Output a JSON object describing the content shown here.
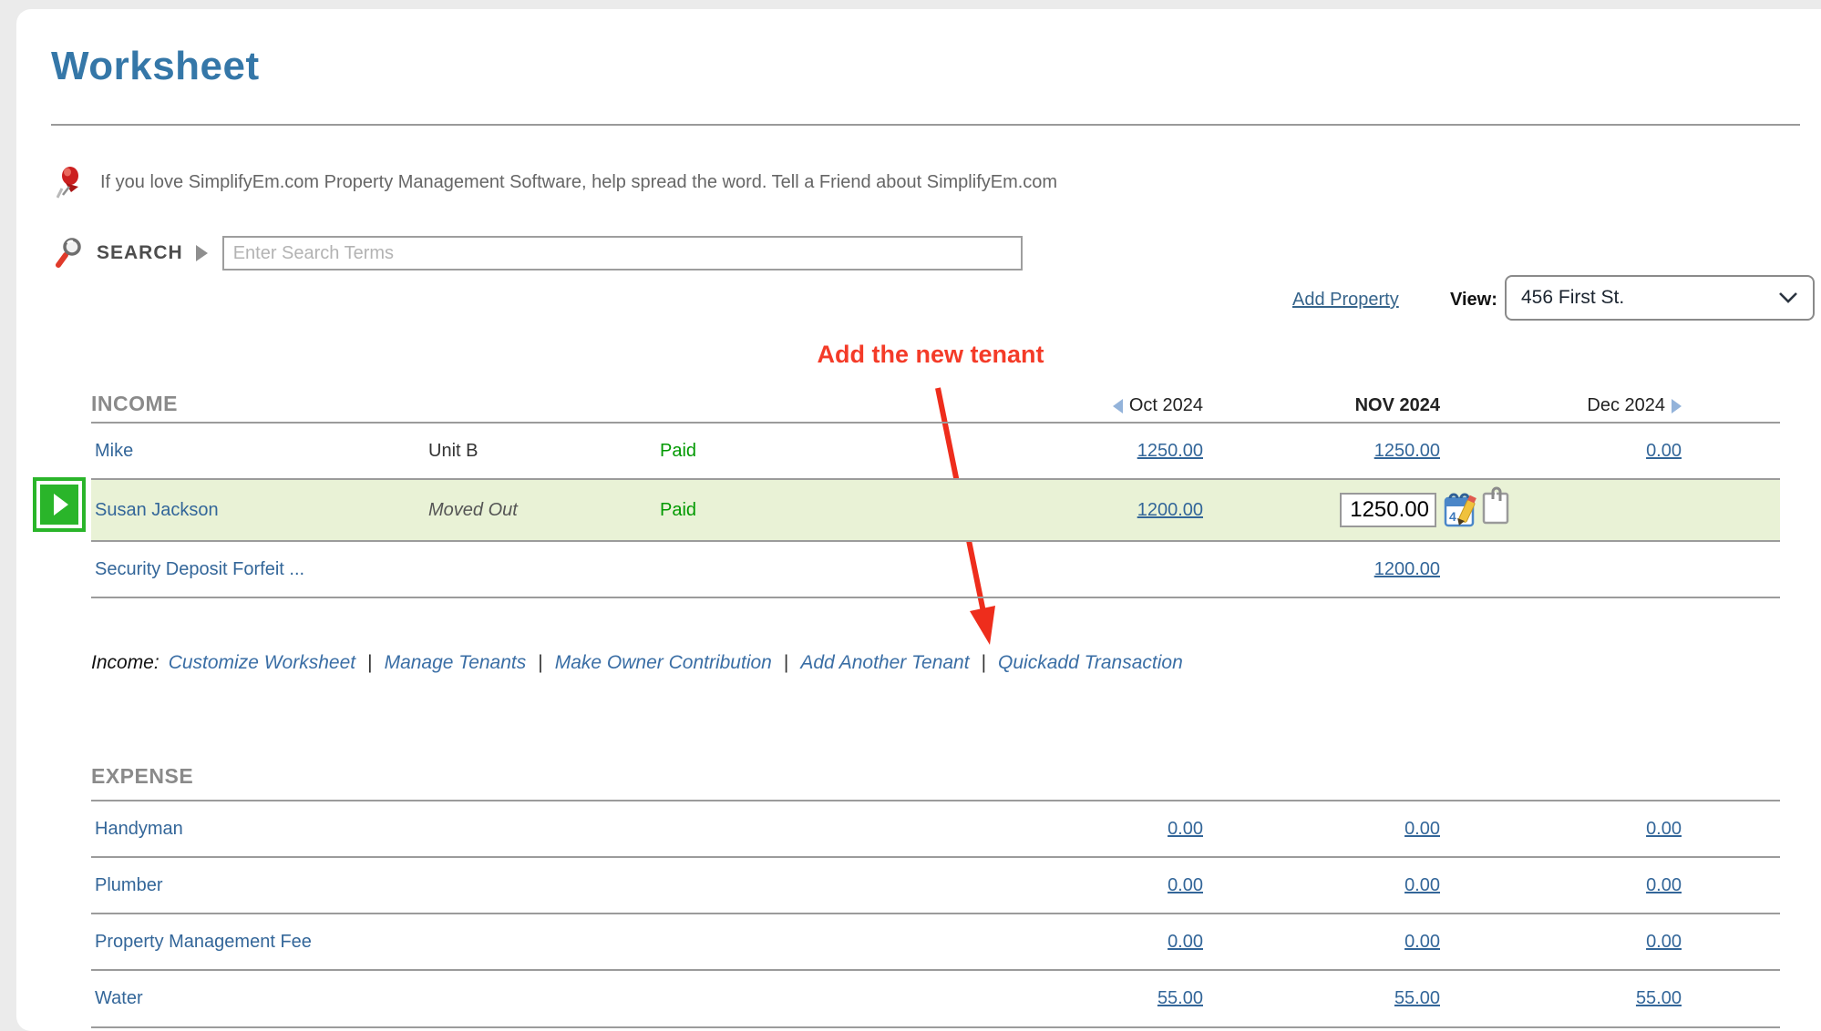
{
  "page": {
    "title": "Worksheet"
  },
  "share": {
    "text": "If you love SimplifyEm.com Property Management Software, help spread the word. Tell a Friend about SimplifyEm.com"
  },
  "search": {
    "label": "SEARCH",
    "placeholder": "Enter Search Terms"
  },
  "property_bar": {
    "add_property": "Add Property",
    "view_label": "View:",
    "view_value": "456 First St."
  },
  "annotation": {
    "text": "Add the new tenant"
  },
  "months": {
    "prev": "Oct 2024",
    "current": "NOV 2024",
    "next": "Dec 2024"
  },
  "income": {
    "section_label": "INCOME",
    "rows": [
      {
        "name": "Mike",
        "unit": "Unit B",
        "status": "Paid",
        "oct": "1250.00",
        "nov": "1250.00",
        "dec": "0.00"
      },
      {
        "name": "Susan Jackson",
        "unit": "Moved Out",
        "status": "Paid",
        "oct": "1200.00",
        "nov_input": "1250.00",
        "dec": ""
      },
      {
        "name": "Security Deposit Forfeit ...",
        "nov": "1200.00"
      }
    ],
    "links_label": "Income:",
    "separator": "|",
    "links": [
      "Customize Worksheet",
      "Manage Tenants",
      "Make Owner Contribution",
      "Add Another Tenant",
      "Quickadd Transaction"
    ]
  },
  "expense": {
    "section_label": "EXPENSE",
    "rows": [
      {
        "name": "Handyman",
        "oct": "0.00",
        "nov": "0.00",
        "dec": "0.00"
      },
      {
        "name": "Plumber",
        "oct": "0.00",
        "nov": "0.00",
        "dec": "0.00"
      },
      {
        "name": "Property Management Fee",
        "oct": "0.00",
        "nov": "0.00",
        "dec": "0.00"
      },
      {
        "name": "Water",
        "oct": "55.00",
        "nov": "55.00",
        "dec": "55.00"
      }
    ]
  },
  "icons": {
    "pin": "red-pushpin",
    "search": "magnifier",
    "calendar_edit": "calendar-with-pencil",
    "note": "paperclip-note",
    "jump": "green-right-arrow-button"
  },
  "colors": {
    "title_blue": "#3577a8",
    "link_blue": "#336699",
    "paid_green": "#009900",
    "annotation_red": "#f43b28",
    "highlight_row": "#e9f2d6",
    "section_grey": "#8a8a8a",
    "button_green": "#2ab52a"
  }
}
